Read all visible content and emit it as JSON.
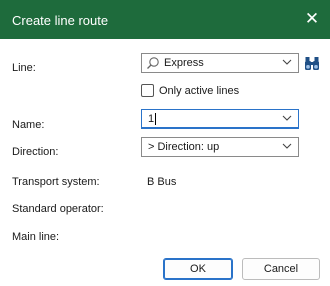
{
  "window": {
    "title": "Create line route",
    "close_glyph": "✕"
  },
  "form": {
    "line": {
      "label": "Line:",
      "value": "Express",
      "search_icon": "magnifier-icon",
      "binoculars_icon": "binoculars-icon"
    },
    "only_active": {
      "label": "Only active lines",
      "checked": false
    },
    "name": {
      "label": "Name:",
      "value": "1"
    },
    "direction": {
      "label": "Direction:",
      "value": "> Direction: up"
    },
    "transport_system": {
      "label": "Transport system:",
      "value": "B Bus"
    },
    "standard_operator": {
      "label": "Standard operator:"
    },
    "main_line": {
      "label": "Main line:"
    }
  },
  "buttons": {
    "ok": "OK",
    "cancel": "Cancel"
  },
  "colors": {
    "titlebar": "#1e6b3c",
    "focus_border": "#2a73c9",
    "binoculars": "#1f4f86"
  }
}
